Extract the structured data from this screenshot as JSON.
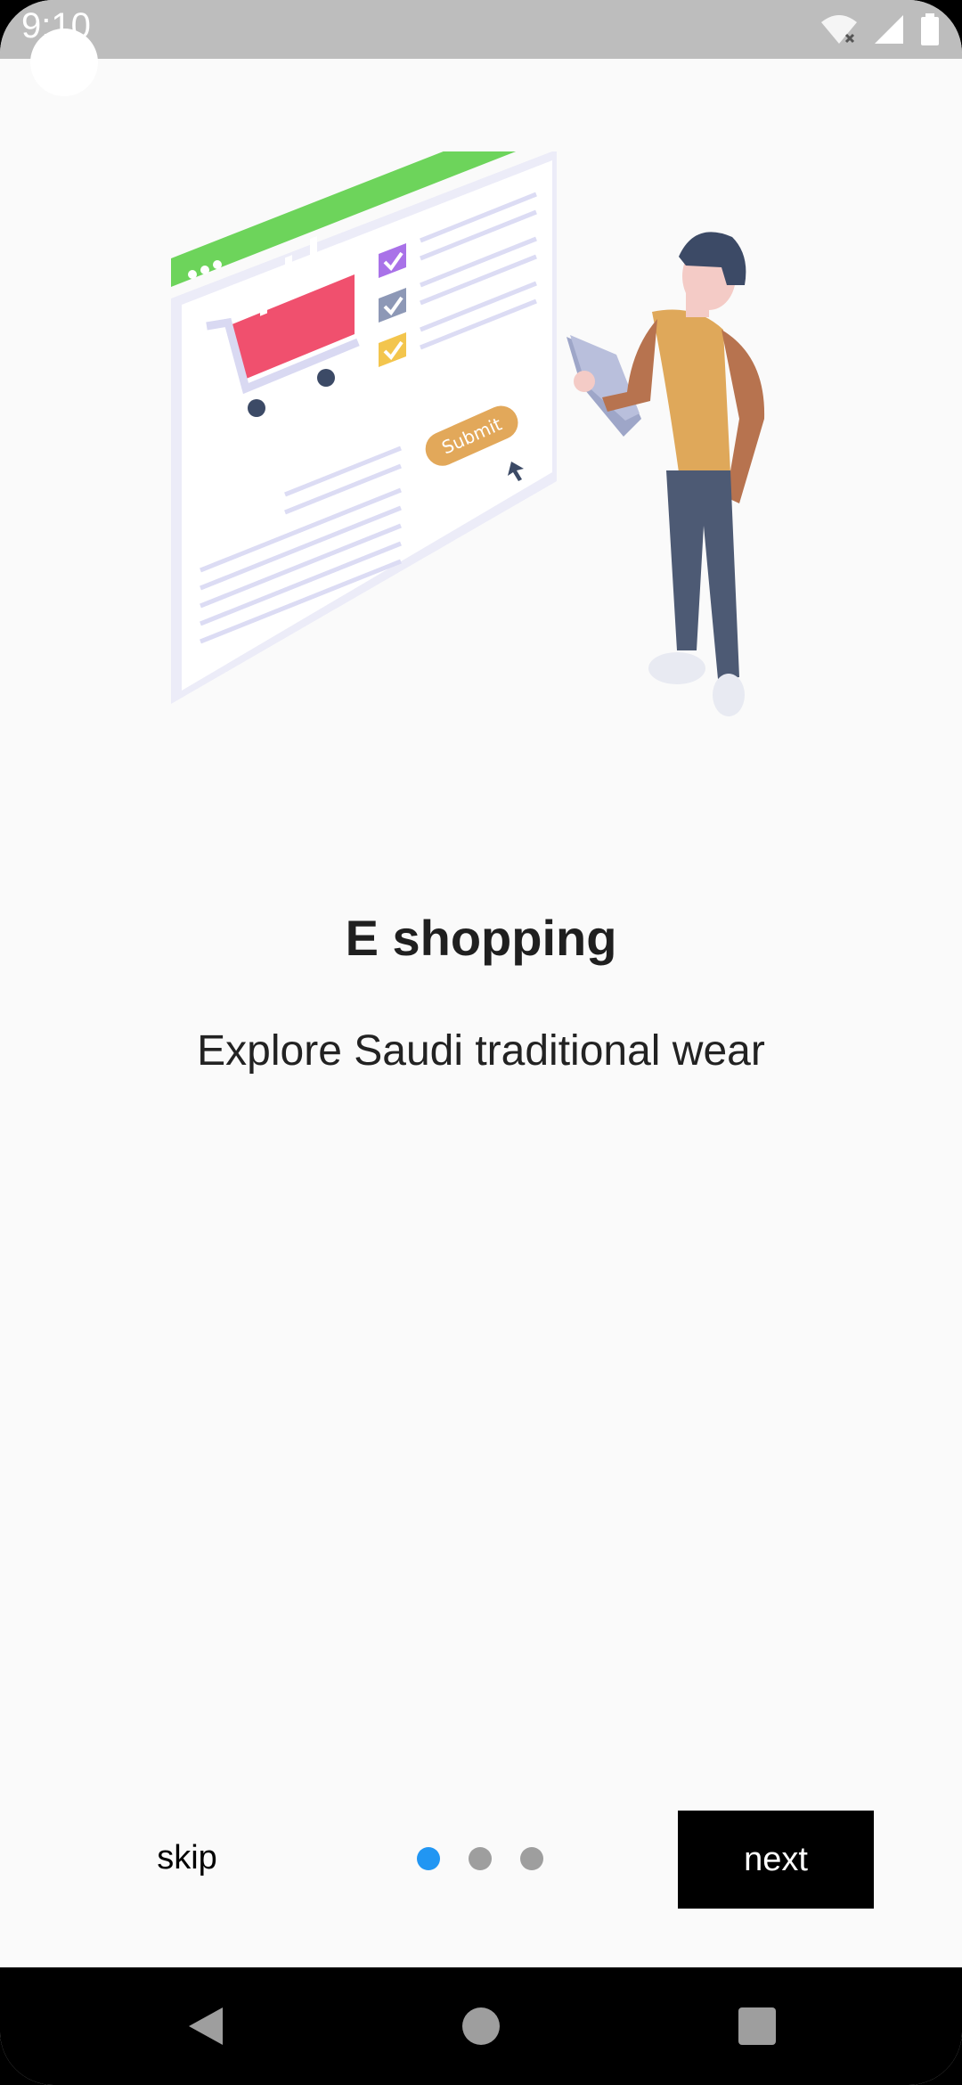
{
  "status_bar": {
    "time": "9:10",
    "icons": [
      "wifi-off-icon",
      "signal-icon",
      "battery-icon"
    ]
  },
  "onboarding": {
    "illustration": "e-shopping-illustration",
    "title": "E shopping",
    "subtitle": "Explore Saudi traditional wear",
    "page_indicator": {
      "total": 3,
      "active": 1
    },
    "skip_label": "skip",
    "next_label": "next"
  },
  "illustration_text": {
    "submit": "Submit"
  },
  "navigation_bar": {
    "icons": [
      "back-icon",
      "home-icon",
      "recents-icon"
    ]
  },
  "colors": {
    "accent": "#2196f3",
    "inactive_dot": "#9e9e9e",
    "button_bg": "#000000",
    "window_bar": "#6dd45b",
    "cart": "#f0506e"
  }
}
